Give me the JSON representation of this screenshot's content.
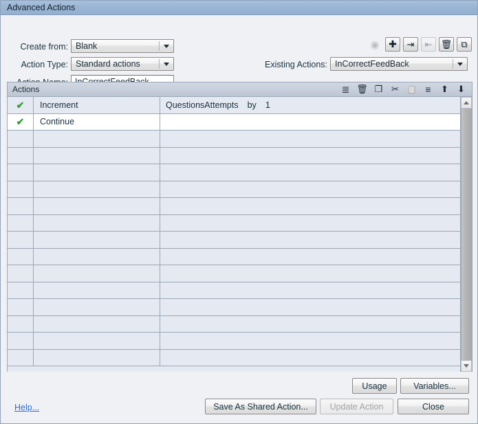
{
  "window": {
    "title": "Advanced Actions"
  },
  "form": {
    "create_from": {
      "label": "Create from:",
      "value": "Blank"
    },
    "action_type": {
      "label": "Action Type:",
      "value": "Standard actions"
    },
    "action_name": {
      "label": "Action Name:",
      "value": "InCorrectFeedBack"
    },
    "existing_actions": {
      "label": "Existing Actions:",
      "value": "InCorrectFeedBack"
    }
  },
  "top_toolbar": [
    {
      "name": "preview-icon",
      "glyph": "▶",
      "enabled": false,
      "framed": false
    },
    {
      "name": "add-icon",
      "glyph": "✚",
      "enabled": true,
      "framed": true
    },
    {
      "name": "export-icon",
      "glyph": "⇥",
      "enabled": true,
      "framed": true
    },
    {
      "name": "import-icon",
      "glyph": "⇤",
      "enabled": false,
      "framed": true
    },
    {
      "name": "delete-icon",
      "glyph": "🗑",
      "enabled": true,
      "framed": true
    },
    {
      "name": "duplicate-icon",
      "glyph": "⧉",
      "enabled": true,
      "framed": true
    }
  ],
  "actions_panel": {
    "title": "Actions",
    "toolbar": [
      {
        "name": "insert-row-icon",
        "glyph": "≣",
        "enabled": true
      },
      {
        "name": "delete-row-icon",
        "glyph": "🗑",
        "enabled": true
      },
      {
        "name": "copy-icon",
        "glyph": "❐",
        "enabled": true
      },
      {
        "name": "cut-icon",
        "glyph": "✂",
        "enabled": true
      },
      {
        "name": "paste-icon",
        "glyph": "📋",
        "enabled": false
      },
      {
        "name": "insert-below-icon",
        "glyph": "≡",
        "enabled": true
      },
      {
        "name": "move-up-icon",
        "glyph": "⬆",
        "enabled": true
      },
      {
        "name": "move-down-icon",
        "glyph": "⬇",
        "enabled": true
      }
    ],
    "rows": [
      {
        "check": "✔",
        "action": "Increment",
        "params": [
          "QuestionsAttempts",
          "by",
          "1"
        ],
        "selected": false
      },
      {
        "check": "✔",
        "action": "Continue",
        "params": [],
        "selected": true
      }
    ],
    "empty_row_count": 14
  },
  "footer": {
    "help": "Help...",
    "usage": "Usage",
    "variables": "Variables...",
    "save_as_shared": "Save As Shared Action...",
    "update_action": "Update Action",
    "close": "Close"
  }
}
